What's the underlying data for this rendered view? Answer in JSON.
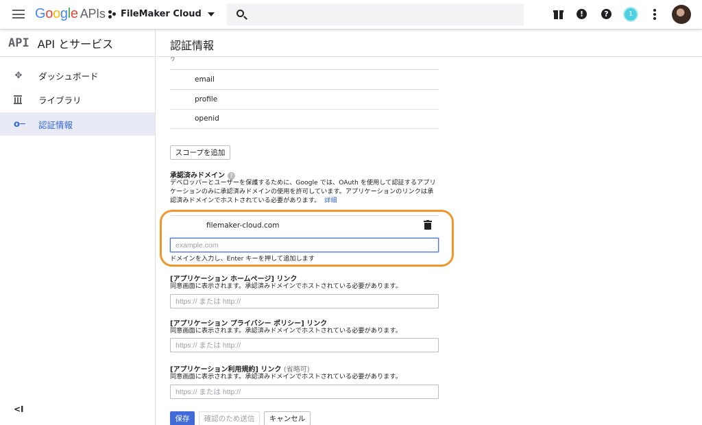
{
  "header": {
    "logo_letters": [
      "G",
      "o",
      "o",
      "g",
      "l",
      "e"
    ],
    "logo_suffix": "APIs",
    "project_name": "FileMaker Cloud",
    "account_initial": "1"
  },
  "sidebar": {
    "api_badge": "API",
    "title": "API とサービス",
    "items": [
      {
        "label": "ダッシュボード",
        "icon": "dashboard-icon"
      },
      {
        "label": "ライブラリ",
        "icon": "library-icon"
      },
      {
        "label": "認証情報",
        "icon": "key-icon",
        "active": true
      }
    ],
    "collapse_label": "<I"
  },
  "main": {
    "page_title": "認証情報",
    "cut_text": "ヮ",
    "scopes": [
      "email",
      "profile",
      "openid"
    ],
    "add_scope_button": "スコープを追加",
    "authorized_domains": {
      "label": "承認済みドメイン",
      "help": "?",
      "description": "デベロッパーとユーザーを保護するために、Google では、OAuth を使用して認証するアプリケーションのみに承認済みドメインの使用を許可しています。アプリケーションのリンクは承認済みドメインでホストされている必要があります。",
      "details_link": "詳細",
      "domains": [
        "filemaker-cloud.com"
      ],
      "input_placeholder": "example.com",
      "input_hint": "ドメインを入力し、Enter キーを押して追加します"
    },
    "homepage_link": {
      "label": "[アプリケーション ホームページ] リンク",
      "description": "同意画面に表示されます。承認済みドメインでホストされている必要があります。",
      "placeholder": "https:// または http://"
    },
    "privacy_link": {
      "label": "[アプリケーション プライバシー ポリシー] リンク",
      "description": "同意画面に表示されます。承認済みドメインでホストされている必要があります。",
      "placeholder": "https:// または http://"
    },
    "tos_link": {
      "label": "[アプリケーション利用規約] リンク",
      "optional": "(省略可)",
      "description": "同意画面に表示されます。承認済みドメインでホストされている必要があります。",
      "placeholder": "https:// または http://"
    },
    "actions": {
      "save": "保存",
      "submit_for_verification": "確認のため送信",
      "cancel": "キャンセル"
    }
  },
  "colors": {
    "primary": "#3f6ad8",
    "highlight": "#f2962c",
    "active_nav_bg": "#e8eaf6"
  }
}
